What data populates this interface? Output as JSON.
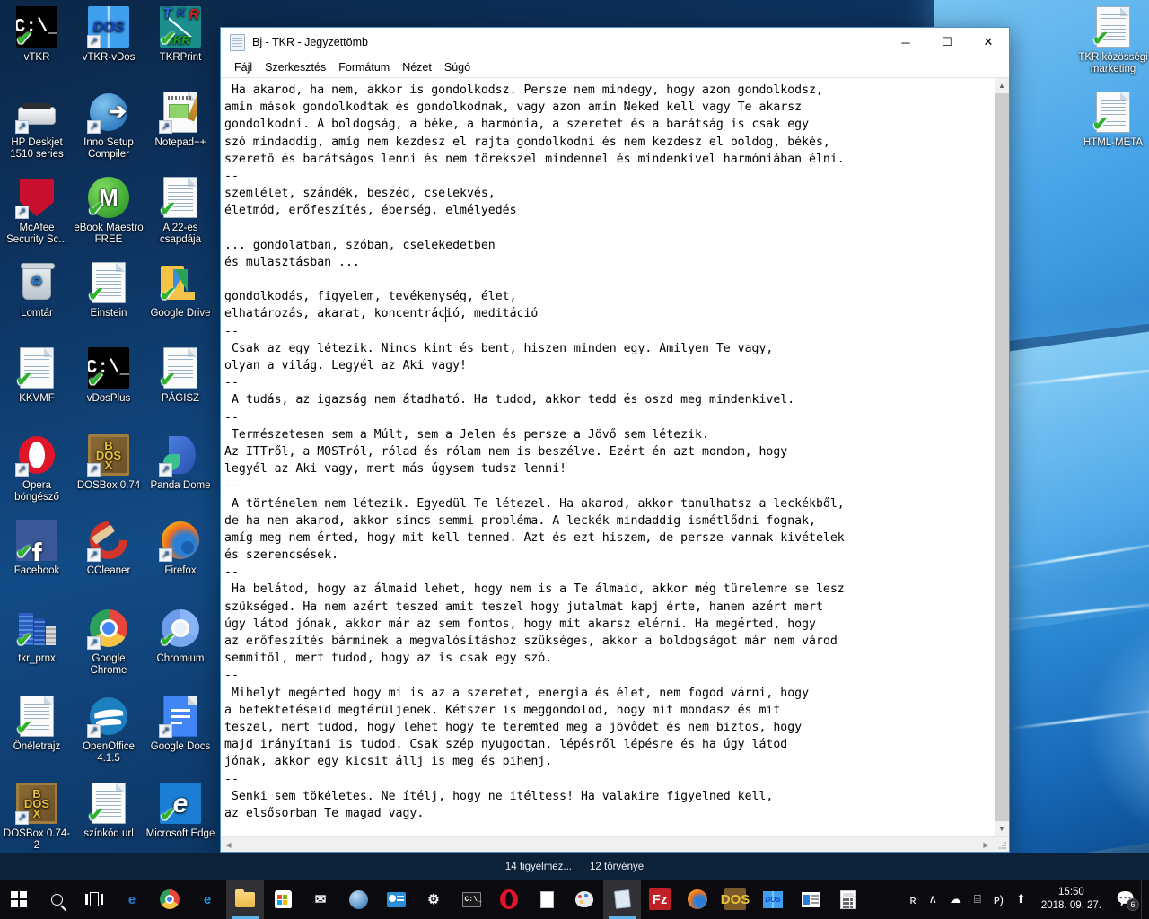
{
  "window": {
    "title": "Bj - TKR - Jegyzettömb",
    "icon": "notepad-icon",
    "minimize_label": "─",
    "maximize_label": "☐",
    "close_label": "✕",
    "menu": [
      "Fájl",
      "Szerkesztés",
      "Formátum",
      "Nézet",
      "Súgó"
    ],
    "text": " Ha akarod, ha nem, akkor is gondolkodsz. Persze nem mindegy, hogy azon gondolkodsz,\namin mások gondolkodtak és gondolkodnak, vagy azon amin Neked kell vagy Te akarsz\ngondolkodni. A boldogság, a béke, a harmónia, a szeretet és a barátság is csak egy\nszó mindaddig, amíg nem kezdesz el rajta gondolkodni és nem kezdesz el boldog, békés,\nszerető és barátságos lenni és nem törekszel mindennel és mindenkivel harmóniában élni.\n--\nszemlélet, szándék, beszéd, cselekvés,\néletmód, erőfeszítés, éberség, elmélyedés\n\n... gondolatban, szóban, cselekedetben\nés mulasztásban ...\n\ngondolkodás, figyelem, tevékenység, élet,\nelhatározás, akarat, koncentráció, meditáció\n--\n Csak az egy létezik. Nincs kint és bent, hiszen minden egy. Amilyen Te vagy,\nolyan a világ. Legyél az Aki vagy!\n--\n A tudás, az igazság nem átadható. Ha tudod, akkor tedd és oszd meg mindenkivel.\n--\n Természetesen sem a Múlt, sem a Jelen és persze a Jövő sem létezik.\nAz ITTről, a MOSTról, rólad és rólam nem is beszélve. Ezért én azt mondom, hogy\nlegyél az Aki vagy, mert más úgysem tudsz lenni!\n--\n A történelem nem létezik. Egyedül Te létezel. Ha akarod, akkor tanulhatsz a leckékből,\nde ha nem akarod, akkor sincs semmi probléma. A leckék mindaddig ismétlődni fognak,\namíg meg nem érted, hogy mit kell tenned. Azt és ezt hiszem, de persze vannak kivételek\nés szerencsések.\n--\n Ha belátod, hogy az álmaid lehet, hogy nem is a Te álmaid, akkor még türelemre se lesz\nszükséged. Ha nem azért teszed amit teszel hogy jutalmat kapj érte, hanem azért mert\núgy látod jónak, akkor már az sem fontos, hogy mit akarsz elérni. Ha megérted, hogy\naz erőfeszítés bárminek a megvalósításhoz szükséges, akkor a boldogságot már nem várod\nsemmitől, mert tudod, hogy az is csak egy szó.\n--\n Mihelyt megérted hogy mi is az a szeretet, energia és élet, nem fogod várni, hogy\na befektetéseid megtérüljenek. Kétszer is meggondolod, hogy mit mondasz és mit\nteszel, mert tudod, hogy lehet hogy te teremted meg a jövődet és nem biztos, hogy\nmajd irányítani is tudod. Csak szép nyugodtan, lépésről lépésre és ha úgy látod\njónak, akkor egy kicsit állj is meg és pihenj.\n--\n Senki sem tökéletes. Ne ítélj, hogy ne itéltess! Ha valakire figyelned kell,\naz elsősorban Te magad vagy."
  },
  "desktop": {
    "icons": [
      {
        "label": "vTKR",
        "art": "dos-cmd",
        "glyph": "C:\\_",
        "check": true,
        "shortcut": false,
        "col": 0,
        "row": 0
      },
      {
        "label": "vTKR-vDos",
        "art": "dos-blue",
        "glyph": "DOS",
        "check": false,
        "shortcut": true,
        "col": 1,
        "row": 0
      },
      {
        "label": "TKRPrint",
        "art": "tkr",
        "glyph": "TKR",
        "check": true,
        "shortcut": false,
        "col": 2,
        "row": 0
      },
      {
        "label": "HP Deskjet 1510 series",
        "art": "printer",
        "glyph": "",
        "check": false,
        "shortcut": true,
        "col": 0,
        "row": 1
      },
      {
        "label": "Inno Setup Compiler",
        "art": "inno",
        "glyph": "",
        "check": false,
        "shortcut": true,
        "col": 1,
        "row": 1
      },
      {
        "label": "Notepad++",
        "art": "npp",
        "glyph": "",
        "check": false,
        "shortcut": true,
        "col": 2,
        "row": 1
      },
      {
        "label": "McAfee Security Sc...",
        "art": "mcafee",
        "glyph": "",
        "check": false,
        "shortcut": true,
        "col": 0,
        "row": 2
      },
      {
        "label": "eBook Maestro FREE",
        "art": "ebook",
        "glyph": "M",
        "check": true,
        "shortcut": false,
        "col": 1,
        "row": 2
      },
      {
        "label": "A 22-es csapdája",
        "art": "doc",
        "glyph": "",
        "check": true,
        "shortcut": false,
        "col": 2,
        "row": 2
      },
      {
        "label": "Lomtár",
        "art": "recycle",
        "glyph": "",
        "check": false,
        "shortcut": false,
        "col": 0,
        "row": 3
      },
      {
        "label": "Einstein",
        "art": "doc",
        "glyph": "",
        "check": true,
        "shortcut": false,
        "col": 1,
        "row": 3
      },
      {
        "label": "Google Drive",
        "art": "gdrive",
        "glyph": "",
        "check": true,
        "shortcut": false,
        "col": 2,
        "row": 3
      },
      {
        "label": "KKVMF",
        "art": "doc",
        "glyph": "",
        "check": true,
        "shortcut": false,
        "col": 0,
        "row": 4
      },
      {
        "label": "vDosPlus",
        "art": "dos-cmd",
        "glyph": "C:\\_",
        "check": true,
        "shortcut": false,
        "col": 1,
        "row": 4
      },
      {
        "label": "PÁGISZ",
        "art": "doc",
        "glyph": "",
        "check": true,
        "shortcut": false,
        "col": 2,
        "row": 4
      },
      {
        "label": "Opera böngésző",
        "art": "opera",
        "glyph": "O",
        "check": false,
        "shortcut": true,
        "col": 0,
        "row": 5
      },
      {
        "label": "DOSBox 0.74",
        "art": "dosbox",
        "glyph": "DOS",
        "check": false,
        "shortcut": true,
        "col": 1,
        "row": 5
      },
      {
        "label": "Panda Dome",
        "art": "panda",
        "glyph": "",
        "check": false,
        "shortcut": true,
        "col": 2,
        "row": 5
      },
      {
        "label": "Facebook",
        "art": "facebook",
        "glyph": "f",
        "check": true,
        "shortcut": false,
        "col": 0,
        "row": 6
      },
      {
        "label": "CCleaner",
        "art": "ccleaner",
        "glyph": "C",
        "check": false,
        "shortcut": true,
        "col": 1,
        "row": 6
      },
      {
        "label": "Firefox",
        "art": "firefox",
        "glyph": "",
        "check": false,
        "shortcut": true,
        "col": 2,
        "row": 6
      },
      {
        "label": "tkr_prnx",
        "art": "city",
        "glyph": "",
        "check": true,
        "shortcut": false,
        "col": 0,
        "row": 7
      },
      {
        "label": "Google Chrome",
        "art": "chrome",
        "glyph": "",
        "check": false,
        "shortcut": true,
        "col": 1,
        "row": 7
      },
      {
        "label": "Chromium",
        "art": "chromium",
        "glyph": "",
        "check": true,
        "shortcut": false,
        "col": 2,
        "row": 7
      },
      {
        "label": "Önéletrajz",
        "art": "doc",
        "glyph": "",
        "check": true,
        "shortcut": false,
        "col": 0,
        "row": 8
      },
      {
        "label": "OpenOffice 4.1.5",
        "art": "openoffice",
        "glyph": "",
        "check": false,
        "shortcut": true,
        "col": 1,
        "row": 8
      },
      {
        "label": "Google Docs",
        "art": "gdocs",
        "glyph": "",
        "check": false,
        "shortcut": true,
        "col": 2,
        "row": 8
      },
      {
        "label": "DOSBox 0.74-2",
        "art": "dosbox",
        "glyph": "DOS",
        "check": false,
        "shortcut": true,
        "col": 0,
        "row": 9
      },
      {
        "label": "színkód url",
        "art": "doc",
        "glyph": "",
        "check": true,
        "shortcut": false,
        "col": 1,
        "row": 9
      },
      {
        "label": "Microsoft Edge",
        "art": "edge",
        "glyph": "e",
        "check": true,
        "shortcut": false,
        "col": 2,
        "row": 9
      }
    ],
    "right_icons": [
      {
        "label": "TKR közösségi marketing",
        "art": "doc",
        "check": true
      },
      {
        "label": "HTML-META",
        "art": "doc",
        "check": true
      }
    ]
  },
  "taskstrip": {
    "items": [
      "14 figyelmez...",
      "12 törvénye"
    ]
  },
  "taskbar": {
    "start_label": "start-icon",
    "items": [
      {
        "name": "start-button",
        "glyph": "⊞",
        "color": "#ffffff",
        "bg": "transparent",
        "active": false
      },
      {
        "name": "search-icon",
        "glyph": "⚲",
        "color": "#ffffff",
        "bg": "transparent",
        "active": false
      },
      {
        "name": "task-view-icon",
        "glyph": "▣",
        "color": "#ffffff",
        "bg": "transparent",
        "active": false
      },
      {
        "name": "edge-icon",
        "glyph": "e",
        "color": "#2a7fd4",
        "bg": "transparent",
        "active": false
      },
      {
        "name": "chrome-icon",
        "glyph": "",
        "color": "#ffffff",
        "bg": "transparent",
        "active": false
      },
      {
        "name": "internet-explorer-icon",
        "glyph": "e",
        "color": "#1a9de0",
        "bg": "transparent",
        "active": false
      },
      {
        "name": "file-explorer-icon",
        "glyph": "",
        "color": "#f3c44a",
        "bg": "transparent",
        "active": true
      },
      {
        "name": "microsoft-store-icon",
        "glyph": "",
        "color": "#ffffff",
        "bg": "transparent",
        "active": false
      },
      {
        "name": "mail-icon",
        "glyph": "✉",
        "color": "#ffffff",
        "bg": "transparent",
        "active": false
      },
      {
        "name": "browser-globe-icon",
        "glyph": "",
        "color": "#4a9fe0",
        "bg": "transparent",
        "active": false
      },
      {
        "name": "contacts-icon",
        "glyph": "",
        "color": "#3aa0e0",
        "bg": "transparent",
        "active": false
      },
      {
        "name": "settings-gear-icon",
        "glyph": "⚙",
        "color": "#ffffff",
        "bg": "transparent",
        "active": false
      },
      {
        "name": "command-prompt-icon",
        "glyph": "",
        "color": "#ffffff",
        "bg": "transparent",
        "active": false
      },
      {
        "name": "opera-icon",
        "glyph": "O",
        "color": "#e0152a",
        "bg": "transparent",
        "active": false
      },
      {
        "name": "document-icon",
        "glyph": "",
        "color": "#ffffff",
        "bg": "transparent",
        "active": false
      },
      {
        "name": "paint-icon",
        "glyph": "",
        "color": "#ffffff",
        "bg": "transparent",
        "active": false
      },
      {
        "name": "notepad-icon",
        "glyph": "",
        "color": "#dfe9f3",
        "bg": "transparent",
        "active": true
      },
      {
        "name": "filezilla-icon",
        "glyph": "Fz",
        "color": "#ffffff",
        "bg": "#bf2026",
        "active": false
      },
      {
        "name": "firefox-icon",
        "glyph": "",
        "color": "#ffffff",
        "bg": "transparent",
        "active": false
      },
      {
        "name": "dosbox-icon",
        "glyph": "DOS",
        "color": "#e8c23a",
        "bg": "#7a5a2a",
        "active": false
      },
      {
        "name": "vdos-icon",
        "glyph": "DOS",
        "color": "#1147c8",
        "bg": "transparent",
        "active": false
      },
      {
        "name": "news-icon",
        "glyph": "",
        "color": "#ffffff",
        "bg": "transparent",
        "active": false
      },
      {
        "name": "calculator-icon",
        "glyph": "",
        "color": "#ffffff",
        "bg": "transparent",
        "active": false
      }
    ],
    "tray": [
      {
        "name": "people-icon",
        "glyph": "ʀ"
      },
      {
        "name": "show-hidden-icons-chevron",
        "glyph": "∧"
      },
      {
        "name": "onedrive-cloud-icon",
        "glyph": "☁"
      },
      {
        "name": "network-icon",
        "glyph": "⌸"
      },
      {
        "name": "volume-icon",
        "glyph": "ᴘ)"
      },
      {
        "name": "update-icon",
        "glyph": "⬆"
      }
    ],
    "clock": {
      "time": "15:50",
      "date": "2018. 09. 27."
    },
    "notifications": {
      "count": "6"
    }
  }
}
